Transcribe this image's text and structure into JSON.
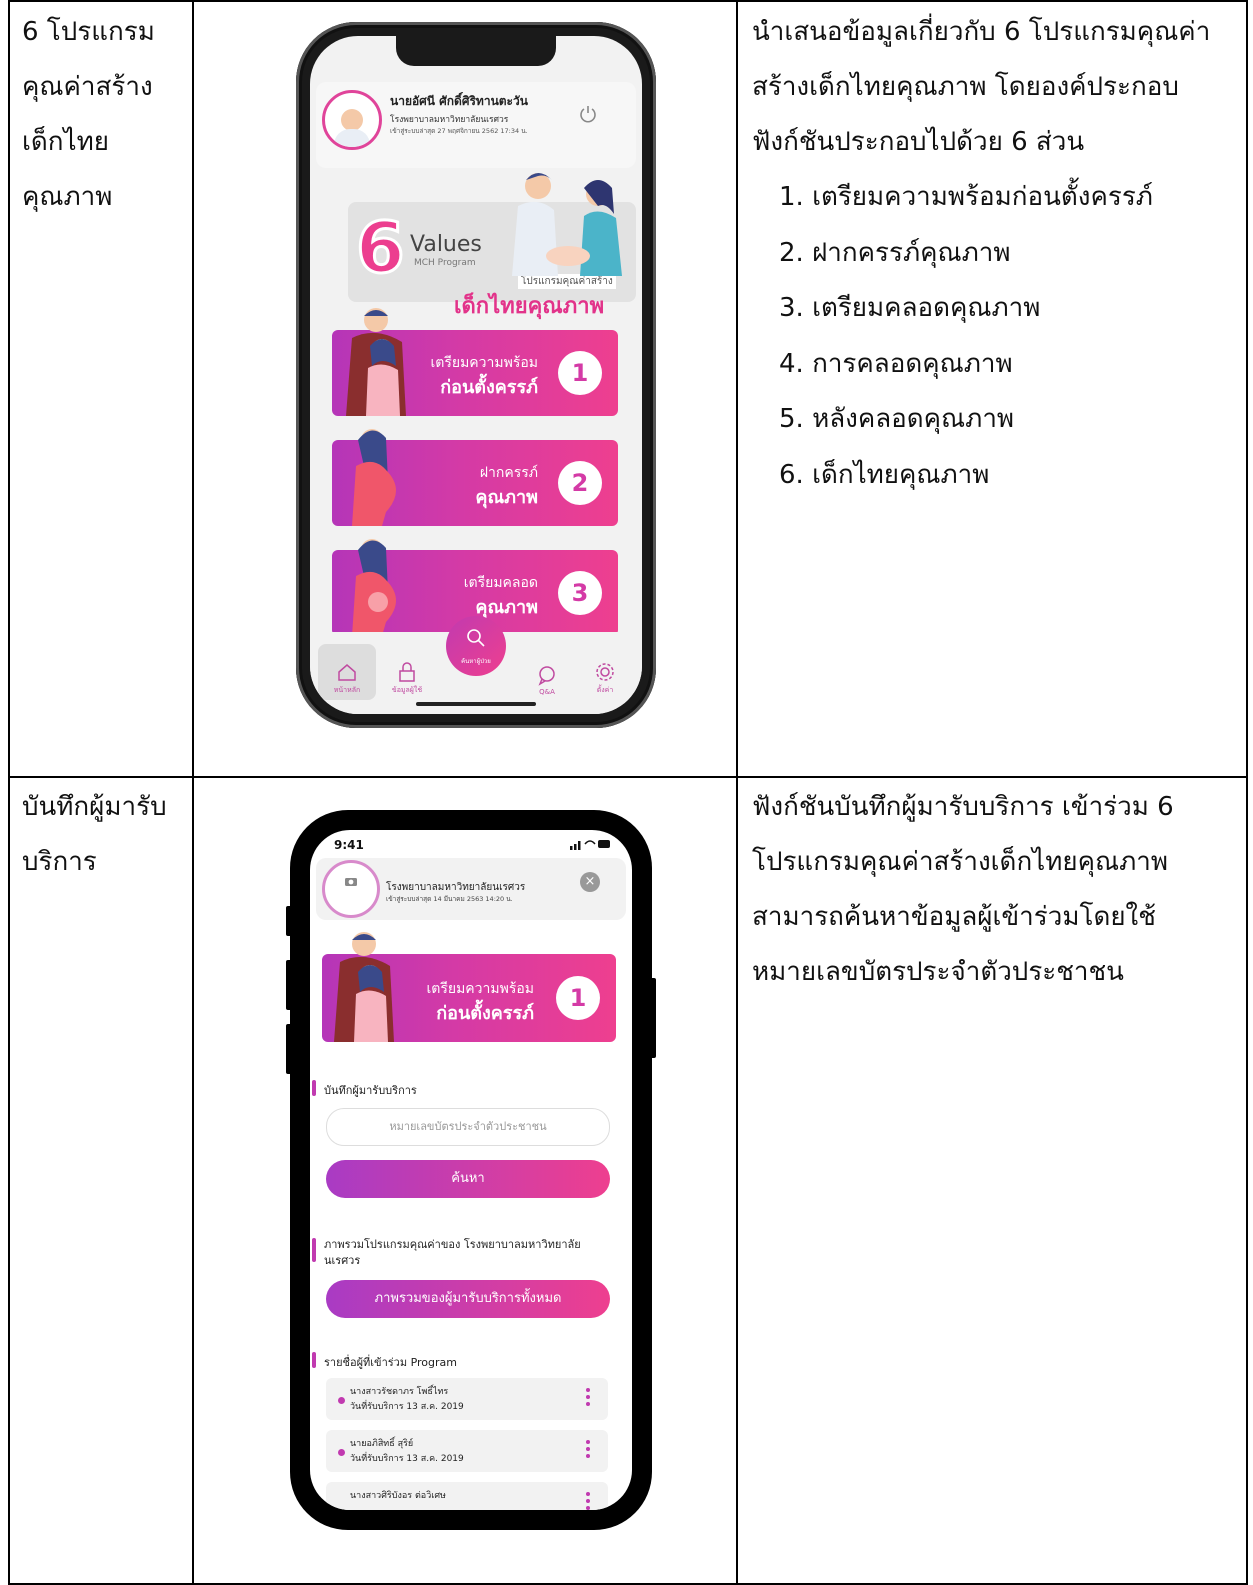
{
  "rows": [
    {
      "label_lines": [
        "6 โปรแกรม",
        "คุณค่าสร้าง",
        "เด็กไทย",
        "คุณภาพ"
      ],
      "description_lines": [
        "นำเสนอข้อมูลเกี่ยวกับ 6 โปรแกรมคุณค่า",
        "สร้างเด็กไทยคุณภาพ โดยองค์ประกอบ",
        "ฟังก์ชันประกอบไปด้วย 6 ส่วน"
      ],
      "list": [
        "1. เตรียมความพร้อมก่อนตั้งครรภ์",
        "2. ฝากครรภ์คุณภาพ",
        "3. เตรียมคลอดคุณภาพ",
        "4. การคลอดคุณภาพ",
        "5. หลังคลอดคุณภาพ",
        "6. เด็กไทยคุณภาพ"
      ]
    },
    {
      "label_lines": [
        "บันทึกผู้มารับ",
        "บริการ"
      ],
      "description_lines": [
        "ฟังก์ชันบันทึกผู้มารับบริการ เข้าร่วม 6",
        "โปรแกรมคุณค่าสร้างเด็กไทยคุณภาพ",
        "สามารถค้นหาข้อมูลผู้เข้าร่วมโดยใช้",
        "หมายเลขบัตรประจำตัวประชาชน"
      ]
    }
  ],
  "phone1": {
    "user_name": "นายอัศนี ศักดิ์ศิริทานตะวัน",
    "hospital": "โรงพยาบาลมหาวิทยาลัยนเรศวร",
    "last_login": "เข้าสู่ระบบล่าสุด 27 พฤศจิกายน 2562 17:34 น.",
    "banner": {
      "big_number": "6",
      "values": "Values",
      "mch": "MCH Program",
      "program_small": "โปรแกรมคุณค่าสร้าง",
      "program_big": "เด็กไทยคุณภาพ"
    },
    "cards": [
      {
        "line1": "เตรียมความพร้อม",
        "line2": "ก่อนตั้งครรภ์",
        "num": "1"
      },
      {
        "line1": "ฝากครรภ์",
        "line2": "คุณภาพ",
        "num": "2"
      },
      {
        "line1": "เตรียมคลอด",
        "line2": "คุณภาพ",
        "num": "3"
      }
    ],
    "tabs": {
      "home": "หน้าหลัก",
      "patient": "ข้อมูลผู้ใช้",
      "search": "ค้นหาผู้ป่วย",
      "qa": "Q&A",
      "settings": "ตั้งค่า"
    },
    "accent": "#ec3e8f"
  },
  "phone2": {
    "time": "9:41",
    "hospital": "โรงพยาบาลมหาวิทยาลัยนเรศวร",
    "last_login": "เข้าสู่ระบบล่าสุด 14 มีนาคม 2563 14:20 น.",
    "card": {
      "line1": "เตรียมความพร้อม",
      "line2": "ก่อนตั้งครรภ์",
      "num": "1"
    },
    "record_title": "บันทึกผู้มารับบริการ",
    "id_placeholder": "หมายเลขบัตรประจำตัวประชาชน",
    "search_button": "ค้นหา",
    "overview_title": "ภาพรวมโปรแกรมคุณค่าของ โรงพยาบาลมหาวิทยาลัย",
    "overview_title2": "นเรศวร",
    "overview_button": "ภาพรวมของผู้มารับบริการทั้งหมด",
    "list_title": "รายชื่อผู้ที่เข้าร่วม Program",
    "entries": [
      {
        "name": "นางสาวรัชดาภร โพธิ์ไทร",
        "date": "วันที่รับบริการ 13 ส.ค. 2019"
      },
      {
        "name": "นายอภิสิทธิ์ สุริย์",
        "date": "วันที่รับบริการ 13 ส.ค. 2019"
      },
      {
        "name": "นางสาวศิริบังอร ต่อวิเศษ",
        "date": ""
      }
    ]
  }
}
